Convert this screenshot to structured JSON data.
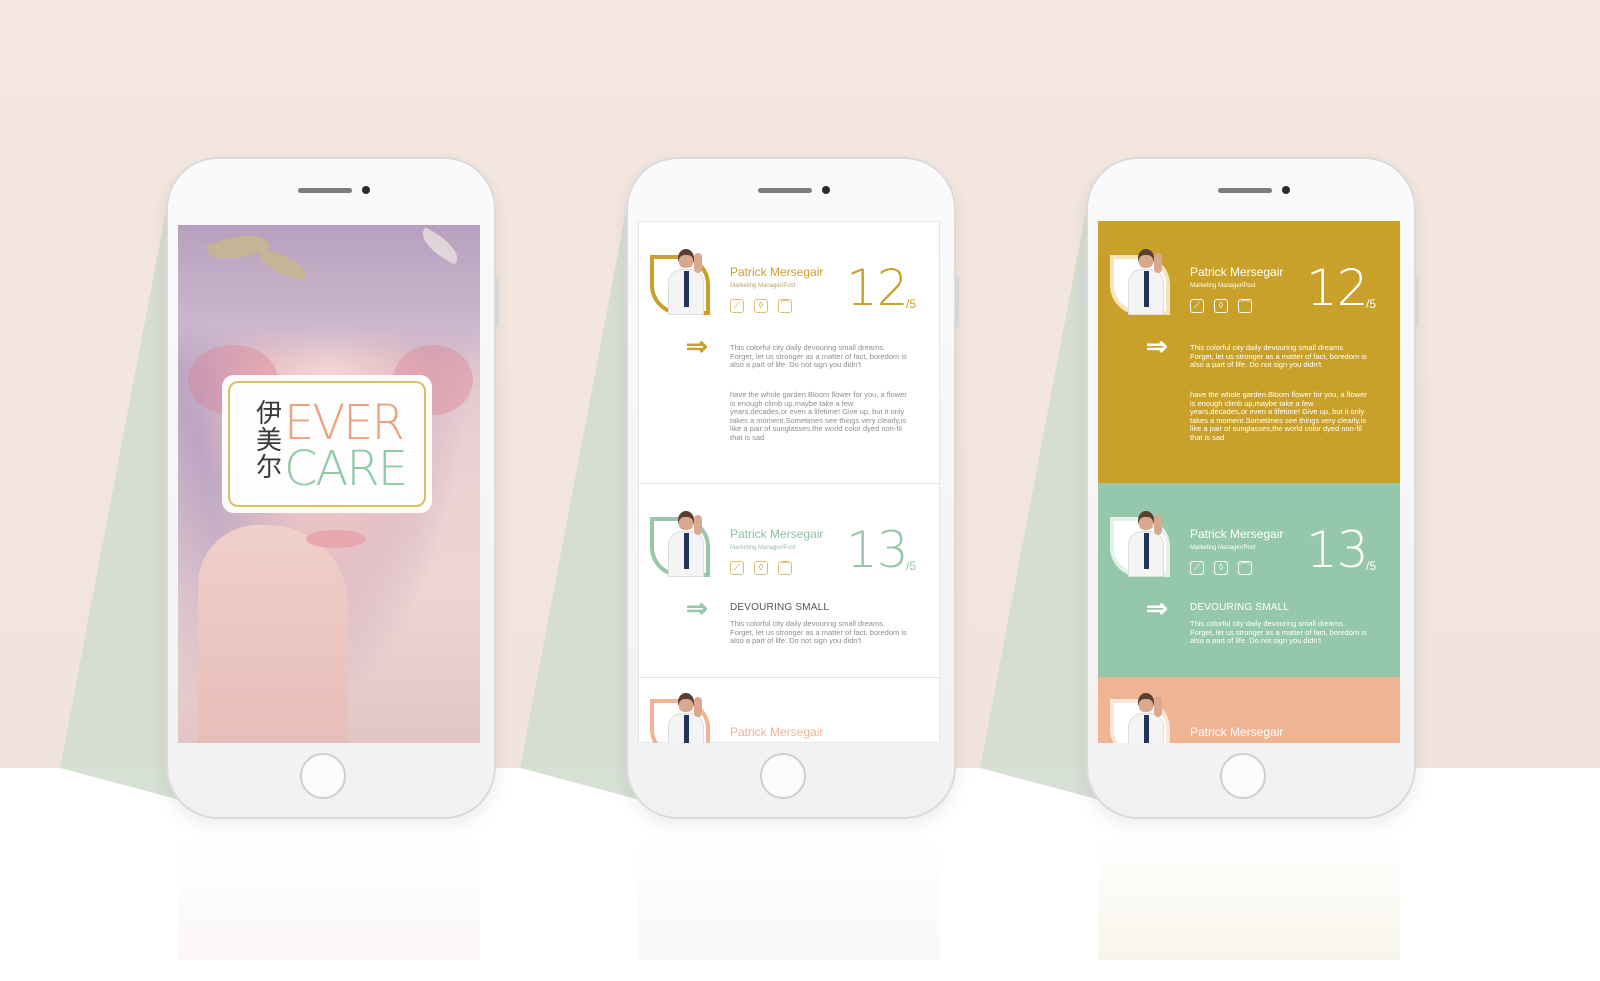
{
  "brand": {
    "cn_line1": "伊",
    "cn_line2": "美",
    "cn_line3": "尔",
    "en_line1": "EVER",
    "en_line2": "CARE"
  },
  "colors": {
    "gold": "#c9a12a",
    "mint": "#95c8ab",
    "peach": "#eeb493",
    "wall": "#f2e6df"
  },
  "cards": [
    {
      "name": "Patrick Mersegair",
      "role": "Marketing Manager/Post",
      "number": "12",
      "denominator": "/5",
      "icons": [
        "chart-icon",
        "badge-icon",
        "hat-icon"
      ],
      "para1": "This colorful city daily devouring small dreams. Forget, let us stronger as a matter of fact, boredom is also a part of life. Do not sign you didn't",
      "para2": "have the whole garden.Bloom flower for you, a flower is enough climb up,maybe take a few years,decades,or even a lifetime! Give up, but it only takes a moment.Sometimes see things very clearly,is like a pair of sunglasses,the world color dyed non-fil that is sad"
    },
    {
      "name": "Patrick Mersegair",
      "role": "Marketing Manager/Post",
      "number": "13",
      "denominator": "/5",
      "icons": [
        "chart-icon",
        "badge-icon",
        "hat-icon"
      ],
      "heading": "DEVOURING SMALL",
      "para1": "This colorful city daily devouring small dreams. Forget, let us stronger as a matter of fact, boredom is also a part of life. Do not sign you didn't"
    },
    {
      "name": "Patrick Mersegair"
    }
  ]
}
